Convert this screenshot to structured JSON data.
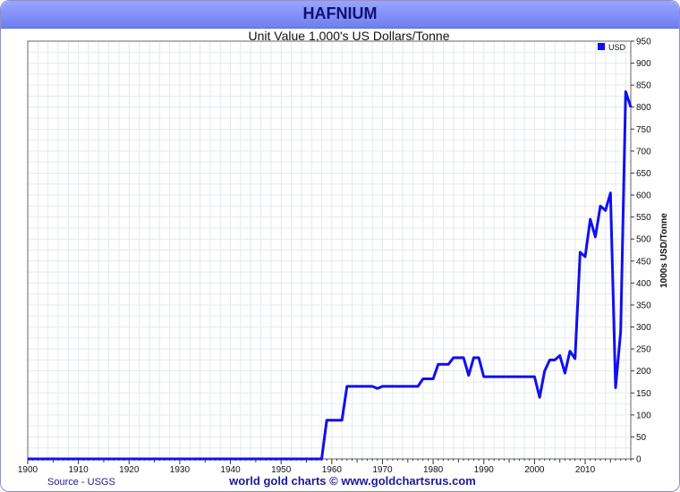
{
  "header": {
    "title": "HAFNIUM"
  },
  "footer": {
    "source": "Source - USGS",
    "credit": "world gold charts © www.goldchartsrus.com"
  },
  "colors": {
    "line": "#1010ee",
    "header": "#7f8cf5",
    "grid": "#e4e9f0"
  },
  "chart_data": {
    "type": "line",
    "title": "Unit Value 1,000's US Dollars/Tonne",
    "xlabel": "",
    "ylabel": "1000s USD/Tonne",
    "xlim": [
      1900,
      2019
    ],
    "ylim": [
      0,
      950
    ],
    "x_ticks": [
      1900,
      1910,
      1920,
      1930,
      1940,
      1950,
      1960,
      1970,
      1980,
      1990,
      2000,
      2010
    ],
    "y_ticks": [
      0,
      50,
      100,
      150,
      200,
      250,
      300,
      350,
      400,
      450,
      500,
      550,
      600,
      650,
      700,
      750,
      800,
      850,
      900,
      950
    ],
    "y_axis_side": "right",
    "grid": true,
    "legend_position": "top-right",
    "series": [
      {
        "name": "USD",
        "color": "#1010ee",
        "x": [
          1900,
          1958,
          1959,
          1960,
          1961,
          1962,
          1963,
          1964,
          1965,
          1966,
          1967,
          1968,
          1969,
          1970,
          1975,
          1977,
          1978,
          1979,
          1980,
          1981,
          1982,
          1983,
          1984,
          1985,
          1986,
          1987,
          1988,
          1989,
          1990,
          1995,
          2000,
          2001,
          2002,
          2003,
          2004,
          2005,
          2006,
          2007,
          2008,
          2009,
          2010,
          2011,
          2012,
          2013,
          2014,
          2015,
          2016,
          2017,
          2018,
          2019
        ],
        "y": [
          0,
          0,
          88,
          88,
          88,
          88,
          165,
          165,
          165,
          165,
          165,
          165,
          160,
          165,
          165,
          165,
          182,
          182,
          182,
          215,
          215,
          215,
          230,
          230,
          230,
          190,
          230,
          230,
          187,
          187,
          187,
          140,
          200,
          225,
          225,
          235,
          195,
          245,
          228,
          470,
          460,
          545,
          505,
          575,
          565,
          605,
          162,
          290,
          835,
          800
        ]
      }
    ]
  }
}
